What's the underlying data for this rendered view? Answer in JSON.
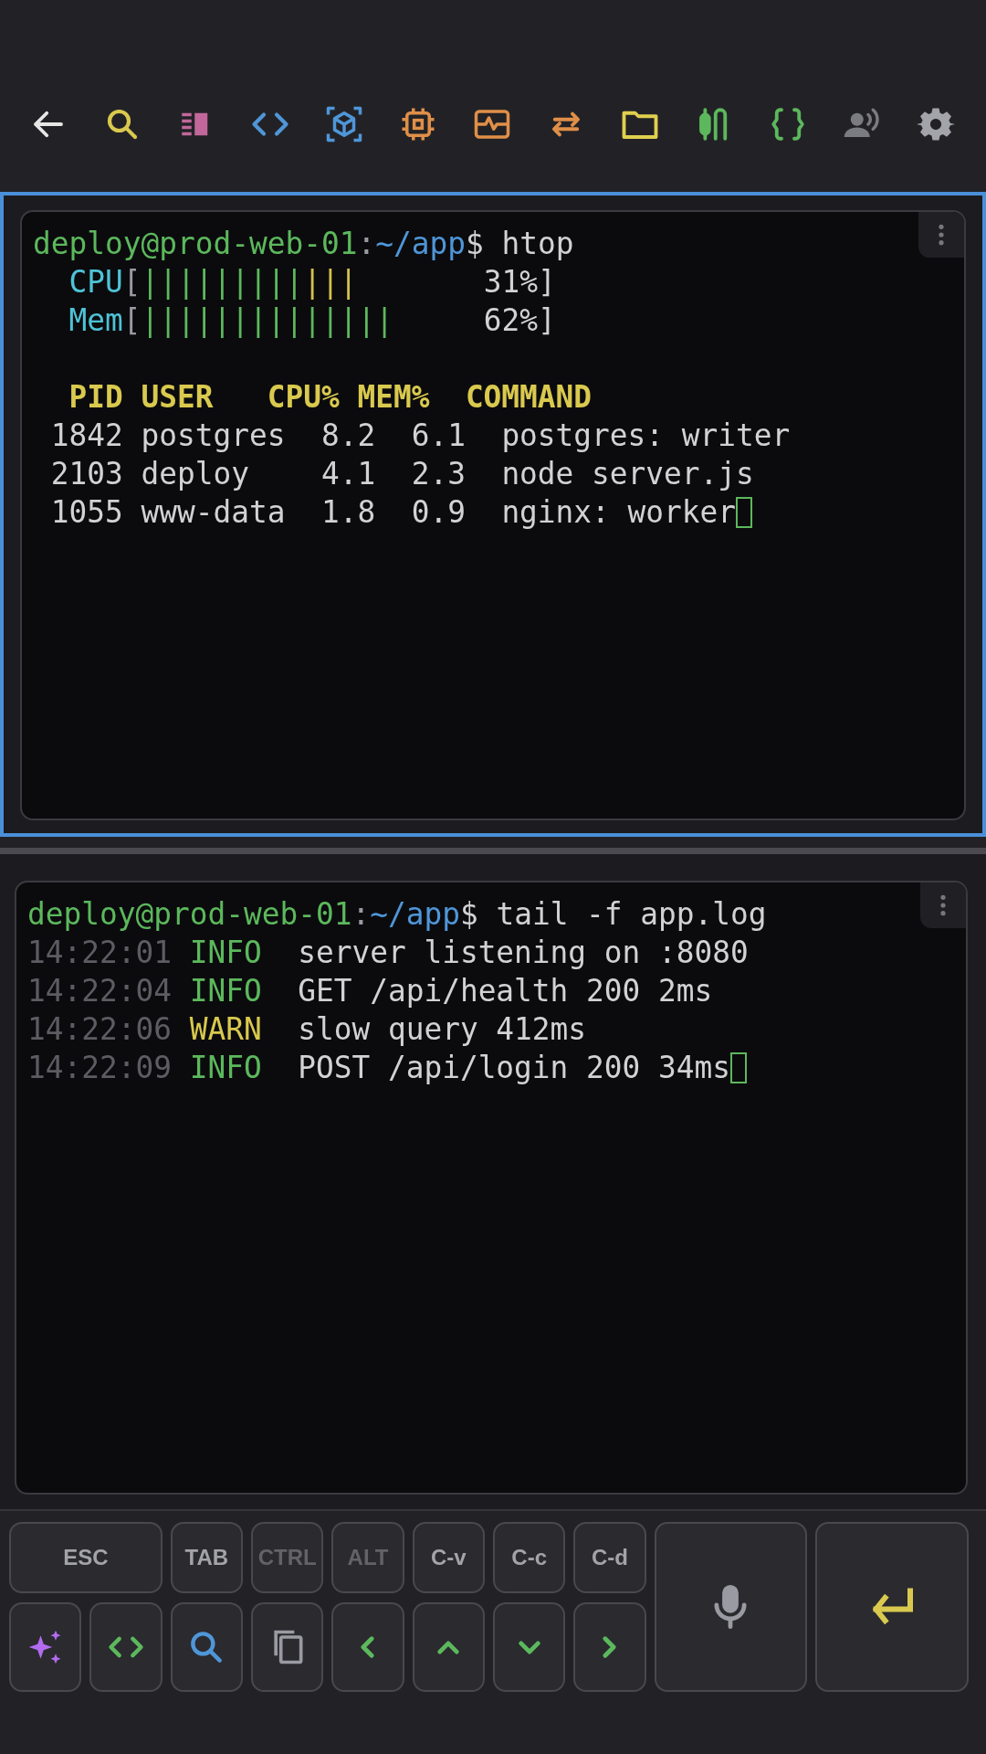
{
  "panes": [
    {
      "kind": "htop",
      "focused": true,
      "prompt": {
        "user_host": "deploy@prod-web-01",
        "separator": ":",
        "path": "~/app",
        "symbol": "$",
        "command": "htop"
      },
      "meters": [
        {
          "label": "CPU",
          "bracket": "[",
          "segments": [
            {
              "text": "|||||||||",
              "color": "#5cb85c"
            },
            {
              "text": "|||",
              "color": "#d4c24a"
            }
          ],
          "reading": "31%]"
        },
        {
          "label": "Mem",
          "bracket": "[",
          "segments": [
            {
              "text": "||||||||||||||",
              "color": "#5cb85c"
            }
          ],
          "reading": "62%]"
        }
      ],
      "process_table": {
        "columns": [
          "PID",
          "USER",
          "CPU%",
          "MEM%",
          "COMMAND"
        ],
        "rows": [
          {
            "cells": [
              "1842",
              "postgres",
              "8.2",
              "6.1",
              "postgres: writer"
            ],
            "cursor": false
          },
          {
            "cells": [
              "2103",
              "deploy",
              "4.1",
              "2.3",
              "node server.js"
            ],
            "cursor": false
          },
          {
            "cells": [
              "1055",
              "www-data",
              "1.8",
              "0.9",
              "nginx: worker"
            ],
            "cursor": true
          }
        ]
      }
    },
    {
      "kind": "log",
      "focused": false,
      "prompt": {
        "user_host": "deploy@prod-web-01",
        "separator": ":",
        "path": "~/app",
        "symbol": "$",
        "command": "tail -f app.log"
      },
      "log_lines": [
        {
          "time": "14:22:01",
          "kind": "info",
          "severity": "INFO",
          "message": "server listening on :8080",
          "cursor": false
        },
        {
          "time": "14:22:04",
          "kind": "info",
          "severity": "INFO",
          "message": "GET /api/health 200 2ms",
          "cursor": false
        },
        {
          "time": "14:22:06",
          "kind": "warn",
          "severity": "WARN",
          "message": "slow query 412ms",
          "cursor": false
        },
        {
          "time": "14:22:09",
          "kind": "info",
          "severity": "INFO",
          "message": "POST /api/login 200 34ms",
          "cursor": true
        }
      ]
    }
  ],
  "keys": [
    {
      "label": "ESC",
      "disabled": false
    },
    {
      "label": "TAB",
      "disabled": false
    },
    {
      "label": "CTRL",
      "disabled": true
    },
    {
      "label": "ALT",
      "disabled": true
    },
    {
      "label": "C-v",
      "disabled": false
    },
    {
      "label": "C-c",
      "disabled": false
    },
    {
      "label": "C-d",
      "disabled": false
    }
  ]
}
